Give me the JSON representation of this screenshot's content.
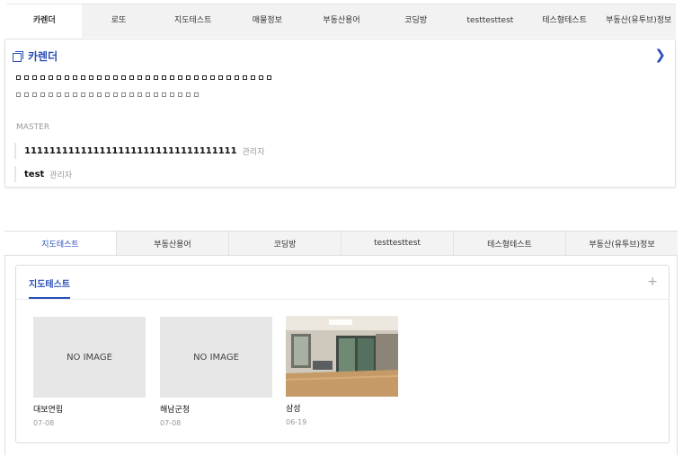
{
  "top_tabs": [
    {
      "label": "카렌더"
    },
    {
      "label": "로또"
    },
    {
      "label": "지도테스트"
    },
    {
      "label": "매물정보"
    },
    {
      "label": "부동산용어"
    },
    {
      "label": "코딩방"
    },
    {
      "label": "testtesttest"
    },
    {
      "label": "테스형테스트"
    },
    {
      "label": "부동산(유투브)정보"
    }
  ],
  "calendar": {
    "title": "카렌더",
    "icon": "copy-icon",
    "next_icon": "chevron-right-icon",
    "master_label": "MASTER",
    "members": [
      {
        "name": "1111111111111111111111111111111111",
        "role": "관리자"
      },
      {
        "name": "test",
        "role": "관리자"
      }
    ]
  },
  "sub_tabs": [
    {
      "label": "지도테스트"
    },
    {
      "label": "부동산용어"
    },
    {
      "label": "코딩방"
    },
    {
      "label": "testtesttest"
    },
    {
      "label": "테스형테스트"
    },
    {
      "label": "부동산(유투브)정보"
    }
  ],
  "map_panel": {
    "title": "지도테스트",
    "add_icon": "plus-icon",
    "cards": [
      {
        "thumb_text": "NO IMAGE",
        "title": "대보연립",
        "date": "07-08"
      },
      {
        "thumb_text": "NO IMAGE",
        "title": "해남군청",
        "date": "07-08"
      },
      {
        "thumb_text": "",
        "title": "삼성",
        "date": "06-19"
      }
    ]
  },
  "colors": {
    "accent": "#2b4fb8",
    "muted": "#999999",
    "tab_bg": "#f2f2f2"
  }
}
